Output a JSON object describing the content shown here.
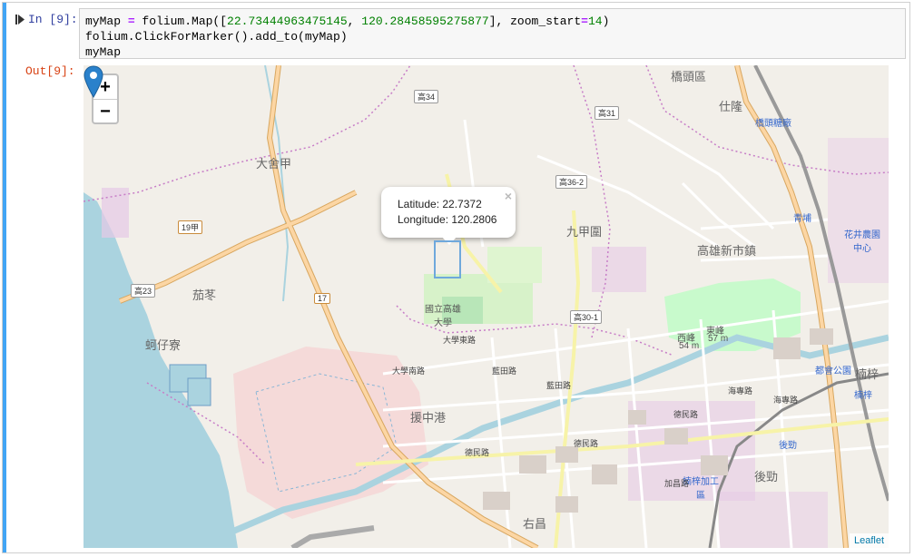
{
  "input_prompt": "In [9]:",
  "output_prompt": "Out[9]:",
  "code": {
    "line1_var": "myMap",
    "line1_eq": " = ",
    "line1_call": "folium.Map([",
    "line1_lat": "22.73444963475145",
    "line1_sep": ", ",
    "line1_lon": "120.28458595275877",
    "line1_zoomkw": "], zoom_start",
    "line1_eq2": "=",
    "line1_zoom": "14",
    "line1_end": ")",
    "line2": "folium.ClickForMarker().add_to(myMap)",
    "line3": "myMap"
  },
  "map": {
    "zoom_in": "+",
    "zoom_out": "−",
    "popup": {
      "latitude": "Latitude: 22.7372",
      "longitude": "Longitude: 120.2806",
      "close": "×"
    },
    "attribution": "Leaflet",
    "labels": {
      "qiaotou": "橋頭區",
      "zilong": "仕隆",
      "qiaotou_station": "橋頭糖廠",
      "dasheja": "大舍甲",
      "jiuhuakuang": "九甲圍",
      "kaohsiung_new": "高雄新市鎮",
      "qiedong": "茄苳",
      "national_uni": "國立高雄大學",
      "zhouzailiao": "蚵仔寮",
      "west_peak": "西峰",
      "west_peak_h": "54 m",
      "east_peak": "東峰",
      "east_peak_h": "57 m",
      "dugong_park": "都會公園",
      "nanzi": "楠梓",
      "houjin": "後勁",
      "houjin2": "後勁",
      "youchang": "右昌",
      "jiagong": "楠梓加工區",
      "huajing": "花井農園中心",
      "zhongqiang": "援中港",
      "qingpu": "青埔",
      "nanzi_right": "楠梓"
    },
    "roads": {
      "r_daxue": "大學南路",
      "r_daxue2": "大學東路",
      "r_lanta": "藍田路",
      "r_lanta2": "藍田路",
      "r_derng": "德民路",
      "r_derng2": "德民路",
      "r_derng3": "德民路",
      "r_jiaxing": "加昌路",
      "r_haixian": "海專路",
      "r_haixian2": "海專路"
    },
    "shields": {
      "s_34": "高34",
      "s_31": "高31",
      "s_362": "高36-2",
      "s_19": "19甲",
      "s_23": "高23",
      "s_17": "17",
      "s_301": "高30-1"
    }
  },
  "colors": {
    "cell_bar": "#42a5f5",
    "water": "#aad3df",
    "park": "#c8facc",
    "major_road": "#fcd6a4",
    "boundary": "#c77dc7",
    "marker": "#2a81cb"
  }
}
